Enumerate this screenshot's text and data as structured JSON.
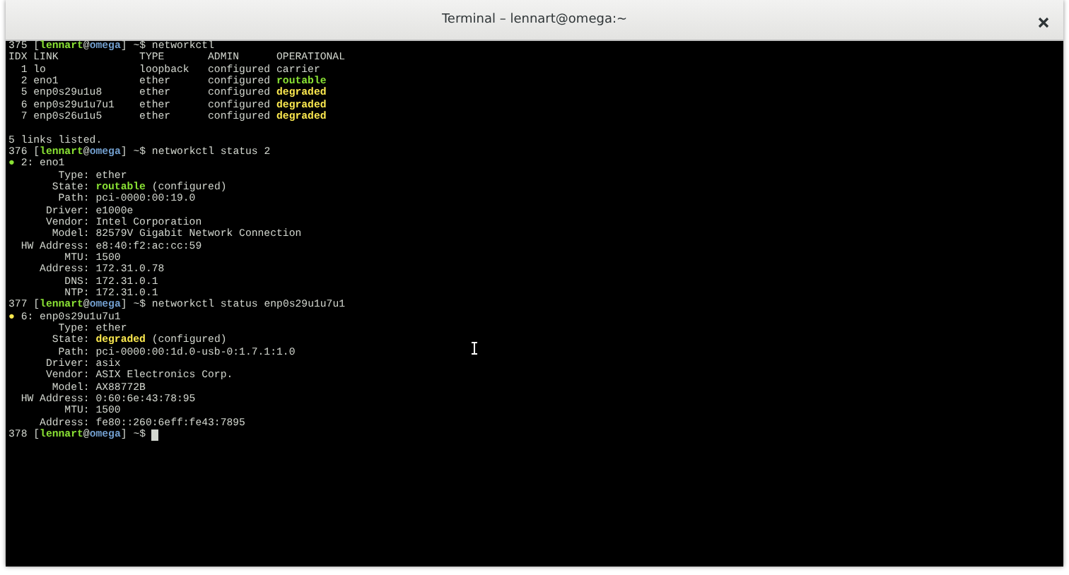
{
  "window": {
    "title": "Terminal – lennart@omega:~"
  },
  "terminal": {
    "lines": [
      {
        "kind": "text",
        "segments": [
          {
            "kind": "plain",
            "text": "375 ["
          },
          {
            "kind": "user",
            "text": "lennart"
          },
          {
            "kind": "plain",
            "text": "@"
          },
          {
            "kind": "host",
            "text": "omega"
          },
          {
            "kind": "plain",
            "text": "] ~$ networkctl"
          }
        ]
      },
      {
        "kind": "text",
        "segments": [
          {
            "kind": "plain",
            "text": "IDX LINK             TYPE       ADMIN      OPERATIONAL"
          }
        ]
      },
      {
        "kind": "text",
        "segments": [
          {
            "kind": "plain",
            "text": "  1 lo               loopback   configured carrier"
          }
        ]
      },
      {
        "kind": "text",
        "segments": [
          {
            "kind": "plain",
            "text": "  2 eno1             ether      configured "
          },
          {
            "kind": "good",
            "text": "routable"
          }
        ]
      },
      {
        "kind": "text",
        "segments": [
          {
            "kind": "plain",
            "text": "  5 enp0s29u1u8      ether      configured "
          },
          {
            "kind": "warn",
            "text": "degraded"
          }
        ]
      },
      {
        "kind": "text",
        "segments": [
          {
            "kind": "plain",
            "text": "  6 enp0s29u1u7u1    ether      configured "
          },
          {
            "kind": "warn",
            "text": "degraded"
          }
        ]
      },
      {
        "kind": "text",
        "segments": [
          {
            "kind": "plain",
            "text": "  7 enp0s26u1u5      ether      configured "
          },
          {
            "kind": "warn",
            "text": "degraded"
          }
        ]
      },
      {
        "kind": "blank"
      },
      {
        "kind": "text",
        "segments": [
          {
            "kind": "plain",
            "text": "5 links listed."
          }
        ]
      },
      {
        "kind": "text",
        "segments": [
          {
            "kind": "plain",
            "text": "376 ["
          },
          {
            "kind": "user",
            "text": "lennart"
          },
          {
            "kind": "plain",
            "text": "@"
          },
          {
            "kind": "host",
            "text": "omega"
          },
          {
            "kind": "plain",
            "text": "] ~$ networkctl status 2"
          }
        ]
      },
      {
        "kind": "text",
        "segments": [
          {
            "kind": "dot",
            "text": "●",
            "color": "#8ae234"
          },
          {
            "kind": "plain",
            "text": " 2: eno1"
          }
        ]
      },
      {
        "kind": "text",
        "segments": [
          {
            "kind": "plain",
            "text": "        Type: ether"
          }
        ]
      },
      {
        "kind": "text",
        "segments": [
          {
            "kind": "plain",
            "text": "       State: "
          },
          {
            "kind": "good",
            "text": "routable"
          },
          {
            "kind": "plain",
            "text": " (configured)"
          }
        ]
      },
      {
        "kind": "text",
        "segments": [
          {
            "kind": "plain",
            "text": "        Path: pci-0000:00:19.0"
          }
        ]
      },
      {
        "kind": "text",
        "segments": [
          {
            "kind": "plain",
            "text": "      Driver: e1000e"
          }
        ]
      },
      {
        "kind": "text",
        "segments": [
          {
            "kind": "plain",
            "text": "      Vendor: Intel Corporation"
          }
        ]
      },
      {
        "kind": "text",
        "segments": [
          {
            "kind": "plain",
            "text": "       Model: 82579V Gigabit Network Connection"
          }
        ]
      },
      {
        "kind": "text",
        "segments": [
          {
            "kind": "plain",
            "text": "  HW Address: e8:40:f2:ac:cc:59"
          }
        ]
      },
      {
        "kind": "text",
        "segments": [
          {
            "kind": "plain",
            "text": "         MTU: 1500"
          }
        ]
      },
      {
        "kind": "text",
        "segments": [
          {
            "kind": "plain",
            "text": "     Address: 172.31.0.78"
          }
        ]
      },
      {
        "kind": "text",
        "segments": [
          {
            "kind": "plain",
            "text": "         DNS: 172.31.0.1"
          }
        ]
      },
      {
        "kind": "text",
        "segments": [
          {
            "kind": "plain",
            "text": "         NTP: 172.31.0.1"
          }
        ]
      },
      {
        "kind": "text",
        "segments": [
          {
            "kind": "plain",
            "text": "377 ["
          },
          {
            "kind": "user",
            "text": "lennart"
          },
          {
            "kind": "plain",
            "text": "@"
          },
          {
            "kind": "host",
            "text": "omega"
          },
          {
            "kind": "plain",
            "text": "] ~$ networkctl status enp0s29u1u7u1"
          }
        ]
      },
      {
        "kind": "text",
        "segments": [
          {
            "kind": "dot",
            "text": "●",
            "color": "#fce94f"
          },
          {
            "kind": "plain",
            "text": " 6: enp0s29u1u7u1"
          }
        ]
      },
      {
        "kind": "text",
        "segments": [
          {
            "kind": "plain",
            "text": "        Type: ether"
          }
        ]
      },
      {
        "kind": "text",
        "segments": [
          {
            "kind": "plain",
            "text": "       State: "
          },
          {
            "kind": "warn",
            "text": "degraded"
          },
          {
            "kind": "plain",
            "text": " (configured)"
          }
        ]
      },
      {
        "kind": "text",
        "segments": [
          {
            "kind": "plain",
            "text": "        Path: pci-0000:00:1d.0-usb-0:1.7.1:1.0"
          }
        ]
      },
      {
        "kind": "text",
        "segments": [
          {
            "kind": "plain",
            "text": "      Driver: asix"
          }
        ]
      },
      {
        "kind": "text",
        "segments": [
          {
            "kind": "plain",
            "text": "      Vendor: ASIX Electronics Corp."
          }
        ]
      },
      {
        "kind": "text",
        "segments": [
          {
            "kind": "plain",
            "text": "       Model: AX88772B"
          }
        ]
      },
      {
        "kind": "text",
        "segments": [
          {
            "kind": "plain",
            "text": "  HW Address: 0:60:6e:43:78:95"
          }
        ]
      },
      {
        "kind": "text",
        "segments": [
          {
            "kind": "plain",
            "text": "         MTU: 1500"
          }
        ]
      },
      {
        "kind": "text",
        "segments": [
          {
            "kind": "plain",
            "text": "     Address: fe80::260:6eff:fe43:7895"
          }
        ]
      },
      {
        "kind": "text",
        "cursor": true,
        "segments": [
          {
            "kind": "plain",
            "text": "378 ["
          },
          {
            "kind": "user",
            "text": "lennart"
          },
          {
            "kind": "plain",
            "text": "@"
          },
          {
            "kind": "host",
            "text": "omega"
          },
          {
            "kind": "plain",
            "text": "] ~$ "
          }
        ]
      }
    ]
  }
}
